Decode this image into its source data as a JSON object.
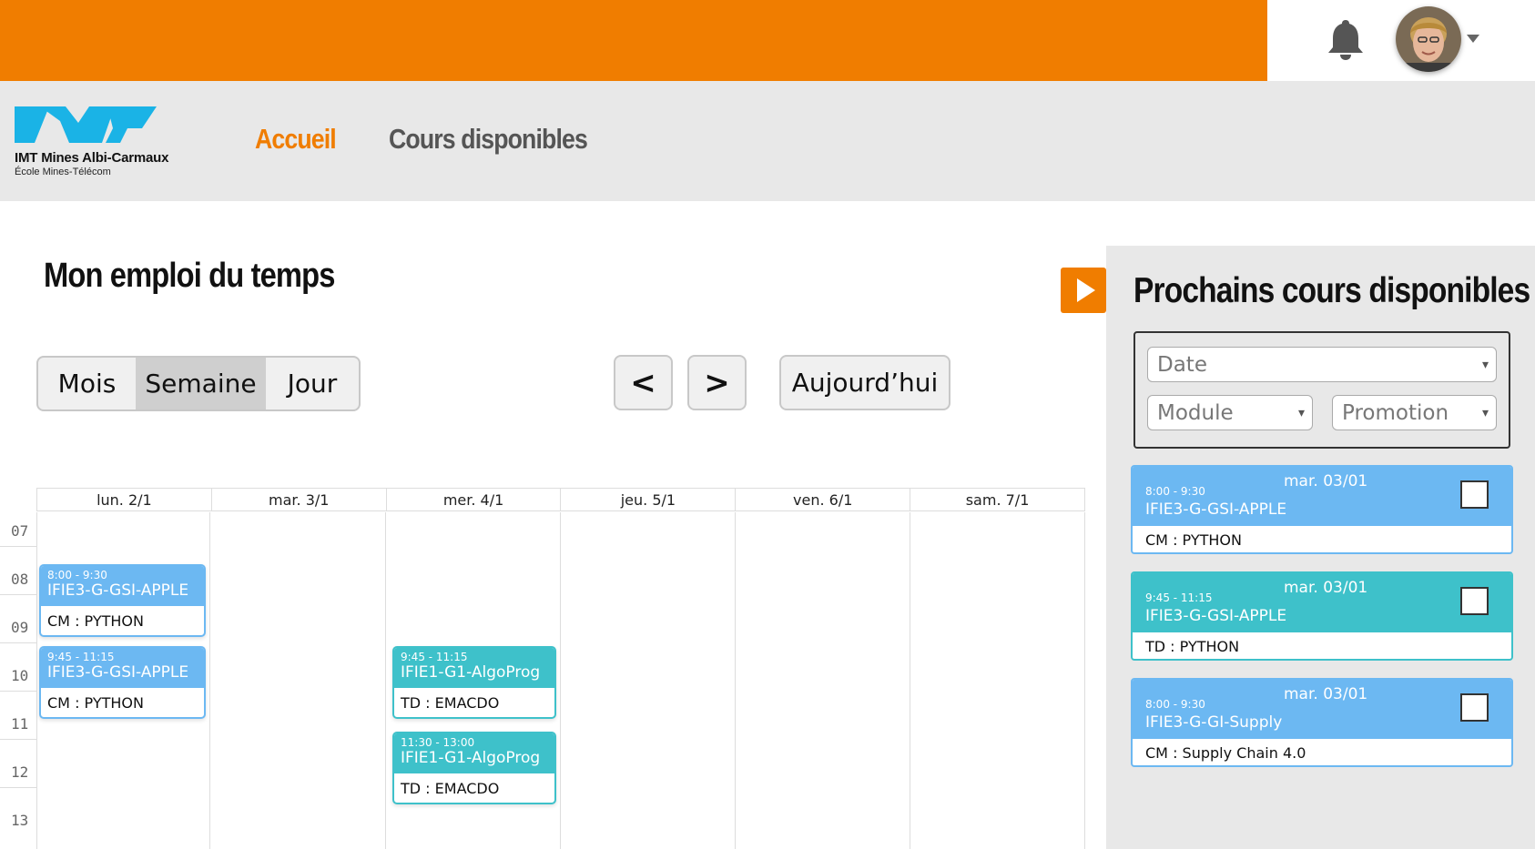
{
  "header": {
    "bell_icon": "bell-icon",
    "avatar_icon": "user-avatar",
    "menu_caret_icon": "chevron-down-icon",
    "accent_color": "#f07d00"
  },
  "logo": {
    "name": "IMT Mines Albi-Carmaux",
    "subtitle": "École Mines-Télécom",
    "color": "#1ab3e6"
  },
  "nav": {
    "home": "Accueil",
    "courses": "Cours disponibles"
  },
  "main": {
    "title": "Mon emploi du temps",
    "views": {
      "month": "Mois",
      "week": "Semaine",
      "day": "Jour",
      "active": "Semaine"
    },
    "prev": "<",
    "next": ">",
    "today": "Aujourd’hui"
  },
  "calendar": {
    "days": [
      "lun. 2/1",
      "mar. 3/1",
      "mer. 4/1",
      "jeu. 5/1",
      "ven. 6/1",
      "sam. 7/1"
    ],
    "hours": [
      "07",
      "08",
      "09",
      "10",
      "11",
      "12",
      "13"
    ],
    "events": [
      {
        "day": 0,
        "time": "8:00 - 9:30",
        "group": "IFIE3-G-GSI-APPLE",
        "course": "CM : PYTHON",
        "color": "#6cb8f2"
      },
      {
        "day": 0,
        "time": "9:45 - 11:15",
        "group": "IFIE3-G-GSI-APPLE",
        "course": "CM : PYTHON",
        "color": "#6cb8f2"
      },
      {
        "day": 2,
        "time": "9:45 - 11:15",
        "group": "IFIE1-G1-AlgoProg",
        "course": "TD : EMACDO",
        "color": "#3ec1ca"
      },
      {
        "day": 2,
        "time": "11:30 - 13:00",
        "group": "IFIE1-G1-AlgoProg",
        "course": "TD : EMACDO",
        "color": "#3ec1ca"
      }
    ]
  },
  "side": {
    "play_icon": "play-icon",
    "title": "Prochains cours disponibles",
    "filters": {
      "date": "Date",
      "module": "Module",
      "promotion": "Promotion"
    },
    "cards": [
      {
        "date": "mar. 03/01",
        "time": "8:00 - 9:30",
        "group": "IFIE3-G-GSI-APPLE",
        "course": "CM : PYTHON",
        "checked": false
      },
      {
        "date": "mar. 03/01",
        "time": "9:45 - 11:15",
        "group": "IFIE3-G-GSI-APPLE",
        "course": "TD : PYTHON",
        "checked": false
      },
      {
        "date": "mar. 03/01",
        "time": "8:00 - 9:30",
        "group": "IFIE3-G-GI-Supply",
        "course": "CM : Supply Chain 4.0",
        "checked": false
      }
    ]
  }
}
